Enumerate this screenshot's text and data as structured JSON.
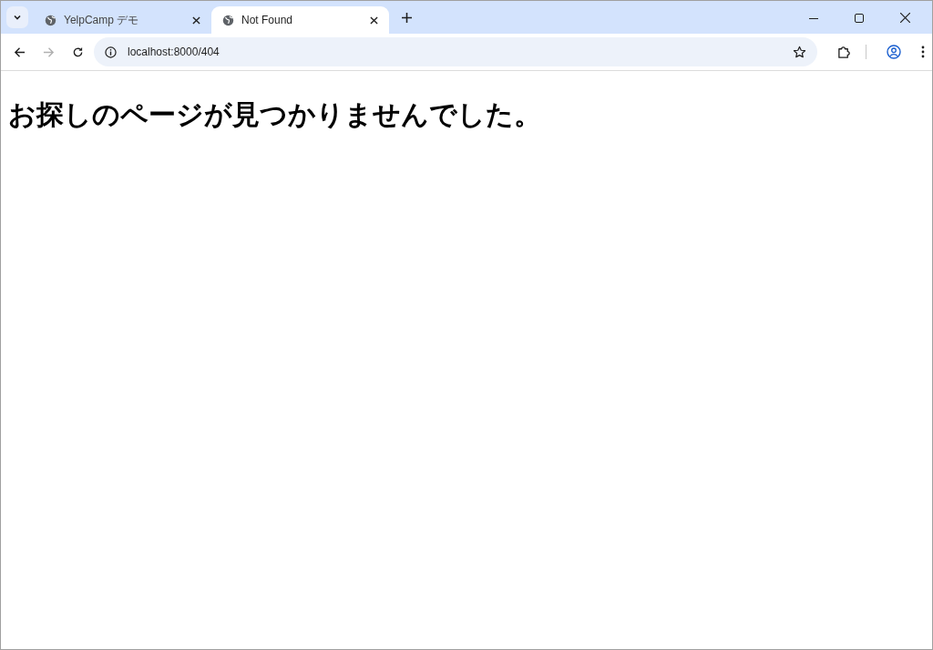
{
  "tabs": [
    {
      "title": "YelpCamp デモ",
      "selected": false
    },
    {
      "title": "Not Found",
      "selected": true
    }
  ],
  "nav": {
    "back_disabled": false,
    "forward_disabled": true
  },
  "address": "localhost:8000/404",
  "page": {
    "heading": "お探しのページが見つかりませんでした。"
  }
}
